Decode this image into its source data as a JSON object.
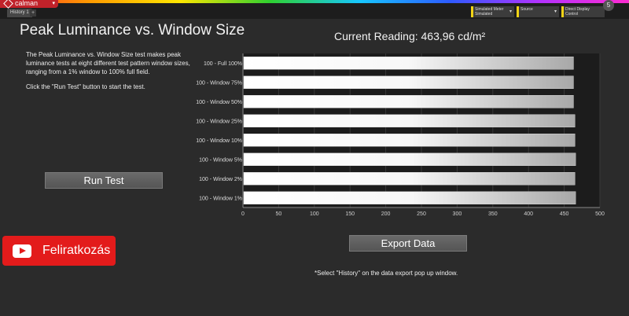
{
  "app": {
    "logo_label": "calman",
    "tab_label": "History 1",
    "tab_add": "+",
    "avatar_label": "5"
  },
  "toolbar": {
    "meter_label": "Simulated Meter",
    "meter_value": "Simulated",
    "source_label": "Source",
    "display_label": "Direct Display Control"
  },
  "page": {
    "title": "Peak Luminance vs. Window Size",
    "reading": "Current Reading: 463,96 cd/m²",
    "description_1": "The Peak Luminance vs. Window Size test makes peak luminance tests at eight different test pattern window sizes, ranging from a 1% window to 100% full field.",
    "description_2": "Click the \"Run Test\" button to start the test.",
    "run_button": "Run Test",
    "export_button": "Export  Data",
    "note": "*Select \"History\" on the data export pop up window."
  },
  "subscribe": {
    "label": "Feliratkozás",
    "color": "#e31b1b"
  },
  "colors": {
    "accent": "#f2d316",
    "brand": "#c1222a"
  },
  "chart_data": {
    "type": "bar",
    "orientation": "horizontal",
    "categories": [
      "100 - Full  100%",
      "100 - Window  75%",
      "100 - Window  50%",
      "100 - Window  25%",
      "100 - Window  10%",
      "100 - Window  5%",
      "100 - Window  2%",
      "100 - Window  1%"
    ],
    "values": [
      463,
      463,
      463,
      465,
      465,
      466,
      465,
      466
    ],
    "xlim": [
      0,
      500
    ],
    "xticks": [
      0,
      50,
      100,
      150,
      200,
      250,
      300,
      350,
      400,
      450,
      500
    ],
    "grid": true
  }
}
